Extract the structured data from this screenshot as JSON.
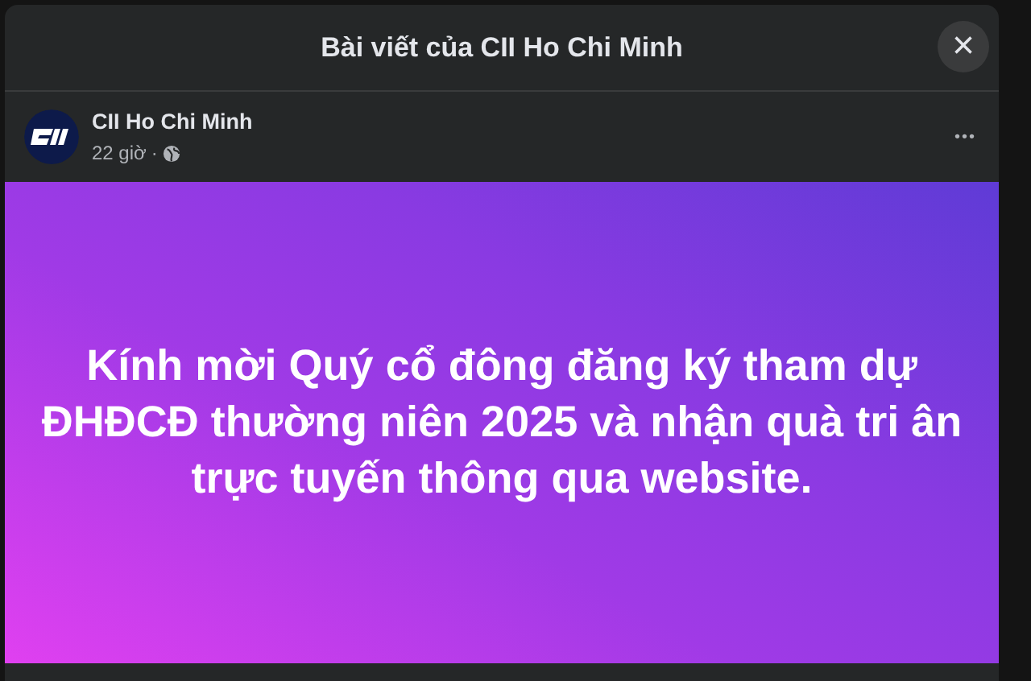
{
  "dialog": {
    "title": "Bài viết của CII Ho Chi Minh",
    "close": "×"
  },
  "post": {
    "author": "CII Ho Chi Minh",
    "time": "22 giờ",
    "separator": "·",
    "more": "•••",
    "message": "Kính mời Quý cổ đông đăng ký tham dự ĐHĐCĐ thường niên 2025 và nhận quà tri ân trực tuyến thông qua website."
  }
}
